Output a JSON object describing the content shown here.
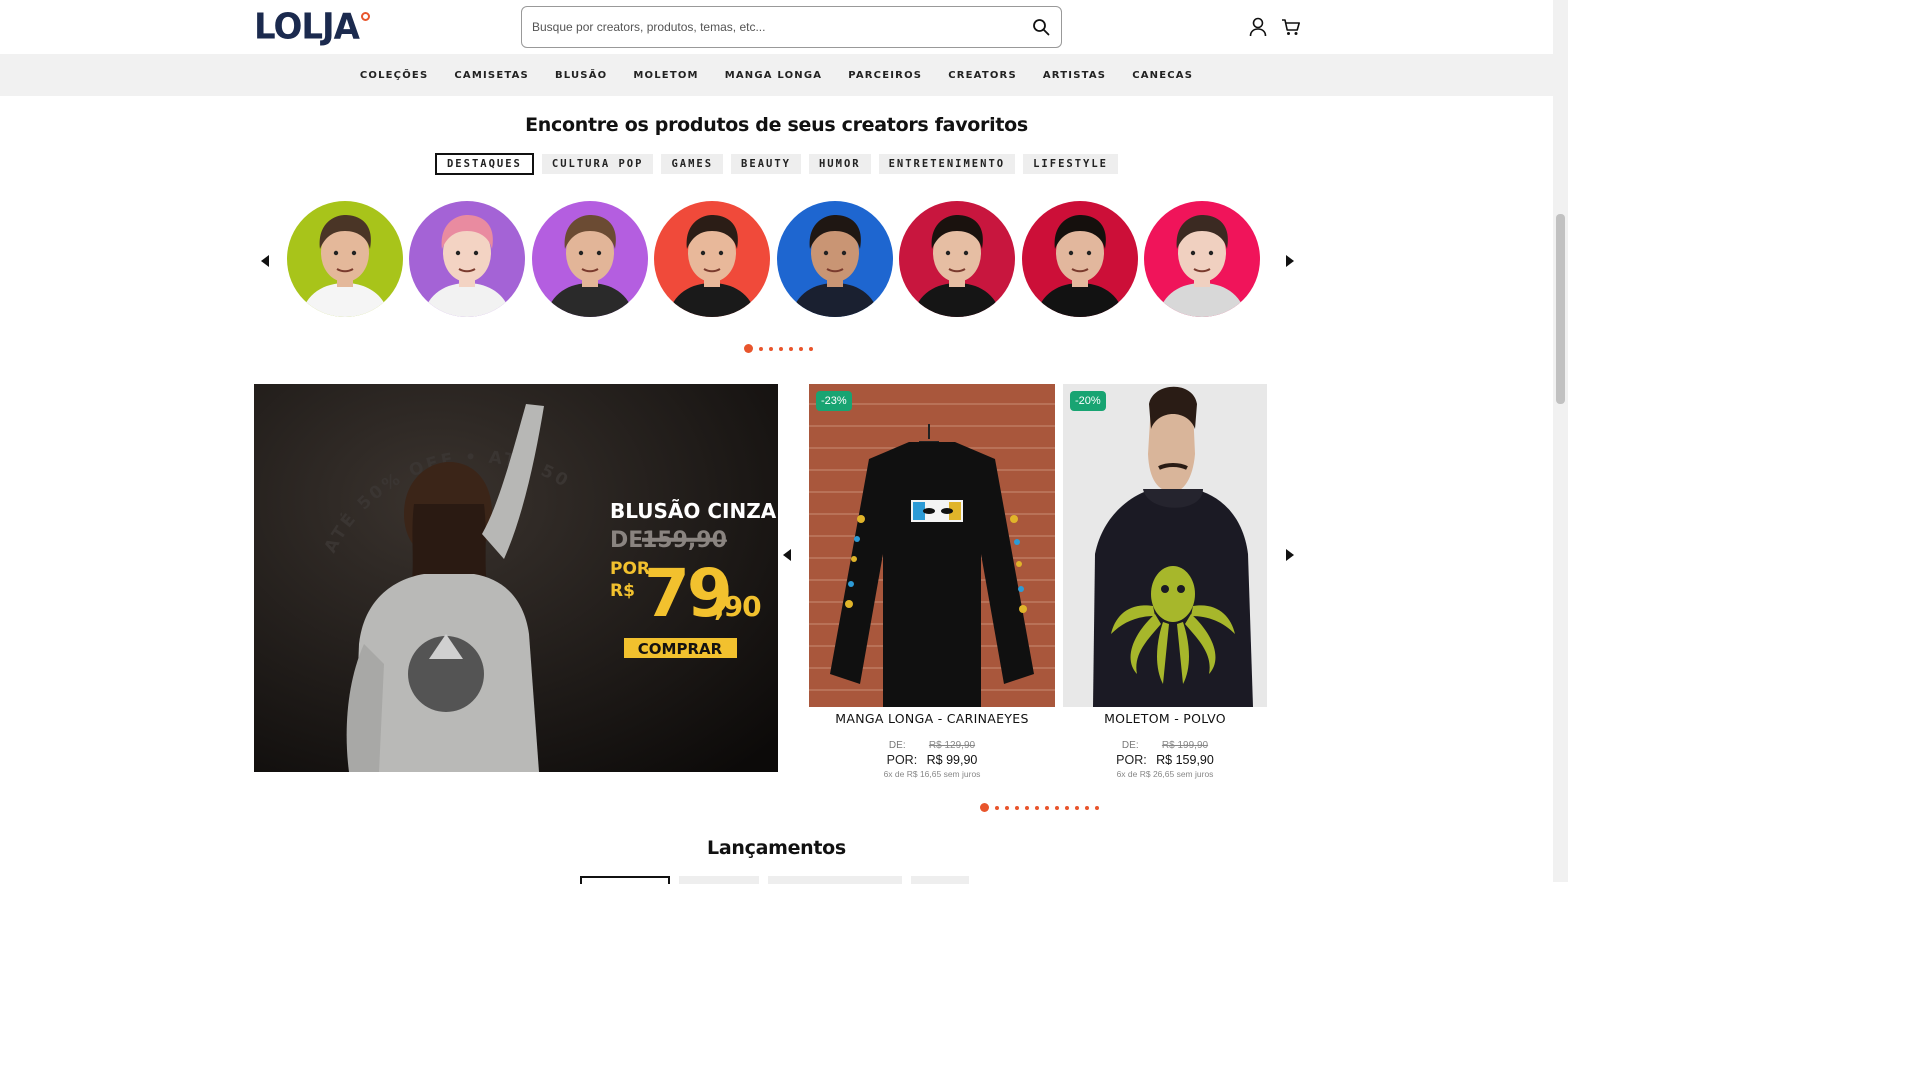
{
  "header": {
    "logo": "LOLJA",
    "search_placeholder": "Busque por creators, produtos, temas, etc...",
    "icons": [
      "search-icon",
      "user-icon",
      "cart-icon"
    ]
  },
  "nav": [
    "COLEÇÕES",
    "CAMISETAS",
    "BLUSÃO",
    "MOLETOM",
    "MANGA LONGA",
    "PARCEIROS",
    "CREATORS",
    "ARTISTAS",
    "CANECAS"
  ],
  "creators_section": {
    "title": "Encontre os produtos de seus creators favoritos",
    "categories": [
      "DESTAQUES",
      "CULTURA POP",
      "GAMES",
      "BEAUTY",
      "HUMOR",
      "ENTRETENIMENTO",
      "LIFESTYLE"
    ],
    "active_category": "DESTAQUES",
    "creator_colors": [
      "#a8c41a",
      "#a463d6",
      "#b45ee0",
      "#f04a3a",
      "#1e66d0",
      "#c8163e",
      "#cc0f38",
      "#f0145a"
    ],
    "carousel_pages": 7,
    "current_page": 1
  },
  "banner": {
    "title": "BLUSÃO CINZA",
    "de_label": "DE",
    "old_price": "159,90",
    "por_label": "POR",
    "currency": "R$",
    "price_int": "79",
    "price_dec": ",90",
    "cta": "COMPRAR",
    "arc_text": "ATÉ 50% OFF • ATÉ 50% OFF •"
  },
  "products": [
    {
      "badge": "-23%",
      "name": "MANGA LONGA - CARINAEYES",
      "de_label": "DE:",
      "old_price": "R$ 129,90",
      "por_label": "POR:",
      "price": "R$ 99,90",
      "installments": "6x de R$ 16,65 sem juros"
    },
    {
      "badge": "-20%",
      "name": "MOLETOM - POLVO",
      "de_label": "DE:",
      "old_price": "R$ 199,90",
      "por_label": "POR:",
      "price": "R$ 159,90",
      "installments": "6x de R$ 26,65 sem juros"
    }
  ],
  "products_carousel_pages": 12,
  "launches": {
    "title": "Lançamentos"
  },
  "colors": {
    "accent": "#e8552c",
    "badge": "#18a472",
    "nav_bg": "#f1f1f1",
    "logo": "#1b2a4e",
    "banner_yellow": "#f2c12e"
  }
}
